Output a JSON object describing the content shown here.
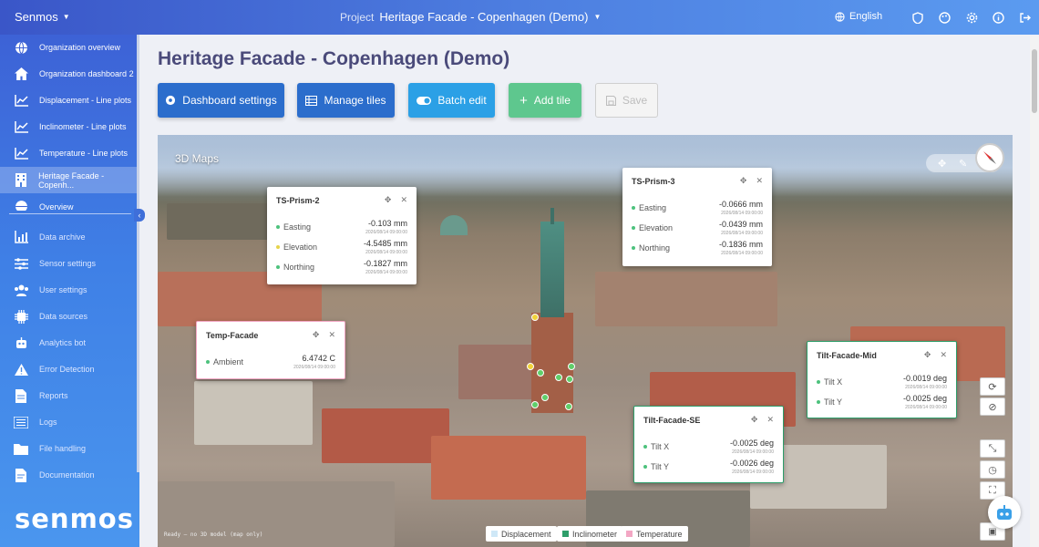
{
  "topbar": {
    "brand": "Senmos",
    "project_label": "Project",
    "project_name": "Heritage Facade - Copenhagen (Demo)",
    "language": "English",
    "icons": [
      "shield-icon",
      "palette-icon",
      "gear-icon",
      "info-icon",
      "logout-icon"
    ]
  },
  "sidebar": {
    "items": [
      {
        "label": "Organization overview",
        "icon": "globe-icon"
      },
      {
        "label": "Organization dashboard 2",
        "icon": "home-icon"
      },
      {
        "label": "Displacement - Line plots",
        "icon": "line-chart-icon"
      },
      {
        "label": "Inclinometer - Line plots",
        "icon": "line-chart-icon"
      },
      {
        "label": "Temperature - Line plots",
        "icon": "line-chart-icon"
      },
      {
        "label": "Heritage Facade - Copenh...",
        "icon": "building-icon",
        "active": true
      },
      {
        "label": "Overview",
        "icon": "globe-icon"
      }
    ],
    "sections": [
      {
        "label": "Data archive",
        "icon": "data-archive-icon"
      },
      {
        "label": "Sensor settings",
        "icon": "sliders-icon"
      },
      {
        "label": "User settings",
        "icon": "users-icon"
      },
      {
        "label": "Data sources",
        "icon": "chip-icon"
      },
      {
        "label": "Analytics bot",
        "icon": "robot-icon"
      },
      {
        "label": "Error Detection",
        "icon": "warning-icon"
      },
      {
        "label": "Reports",
        "icon": "report-icon"
      },
      {
        "label": "Logs",
        "icon": "list-icon"
      },
      {
        "label": "File handling",
        "icon": "folder-icon"
      },
      {
        "label": "Documentation",
        "icon": "document-icon"
      }
    ],
    "logo": "senmos"
  },
  "page": {
    "title": "Heritage Facade - Copenhagen (Demo)",
    "buttons": {
      "dashboard_settings": "Dashboard settings",
      "manage_tiles": "Manage tiles",
      "batch_edit": "Batch edit",
      "add_tile": "Add tile",
      "save": "Save"
    }
  },
  "map": {
    "title": "3D Maps",
    "status": "Ready — no 3D model (map only)",
    "legend": [
      {
        "label": "Displacement",
        "color": "#cfe8f7"
      },
      {
        "label": "Inclinometer",
        "color": "#2e9e6a"
      },
      {
        "label": "Temperature",
        "color": "#f3a7c4"
      }
    ],
    "cards": {
      "prism2": {
        "title": "TS-Prism-2",
        "rows": [
          {
            "name": "Easting",
            "value": "-0.103 mm",
            "ts": "2026/08/14 09:00:00"
          },
          {
            "name": "Elevation",
            "value": "-4.5485 mm",
            "ts": "2026/08/14 09:00:00"
          },
          {
            "name": "Northing",
            "value": "-0.1827 mm",
            "ts": "2026/08/14 09:00:00"
          }
        ]
      },
      "prism3": {
        "title": "TS-Prism-3",
        "rows": [
          {
            "name": "Easting",
            "value": "-0.0666 mm",
            "ts": "2026/08/14 09:00:00"
          },
          {
            "name": "Elevation",
            "value": "-0.0439 mm",
            "ts": "2026/08/14 09:00:00"
          },
          {
            "name": "Northing",
            "value": "-0.1836 mm",
            "ts": "2026/08/14 09:00:00"
          }
        ]
      },
      "temp": {
        "title": "Temp-Facade",
        "rows": [
          {
            "name": "Ambient",
            "value": "6.4742 C",
            "ts": "2026/08/14 09:00:00"
          }
        ]
      },
      "tiltmid": {
        "title": "Tilt-Facade-Mid",
        "rows": [
          {
            "name": "Tilt X",
            "value": "-0.0019 deg",
            "ts": "2026/08/14 09:00:00"
          },
          {
            "name": "Tilt Y",
            "value": "-0.0025 deg",
            "ts": "2026/08/14 09:00:00"
          }
        ]
      },
      "tiltse": {
        "title": "Tilt-Facade-SE",
        "rows": [
          {
            "name": "Tilt X",
            "value": "-0.0025 deg",
            "ts": "2026/08/14 09:00:00"
          },
          {
            "name": "Tilt Y",
            "value": "-0.0026 deg",
            "ts": "2026/08/14 09:00:00"
          }
        ]
      }
    }
  }
}
